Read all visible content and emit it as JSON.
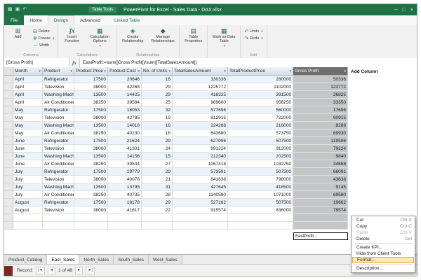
{
  "window": {
    "title": "PowerPivot for Excel - Sales Data - DAX.xlsx",
    "contextual_group": "Table Tools"
  },
  "icons": {
    "app": "▦",
    "save": "▣",
    "undo_small": "↶",
    "minimize": "─",
    "maximize": "□",
    "close": "×",
    "filter": "▾",
    "dropdown": "▾",
    "add": "⊞",
    "delete": "⊟",
    "freeze": "❄",
    "width": "↔",
    "insert_function": "fx",
    "calculation_options": "▦",
    "create_relationship": "◈",
    "manage_relationships": "◆",
    "table_properties": "▤",
    "mark_as_date_table": "▦",
    "undo": "↶",
    "redo": "↷",
    "nav_first": "|◄",
    "nav_prev": "◄",
    "nav_next": "►",
    "nav_last": "►|"
  },
  "ribbon_tabs": [
    {
      "label": "File",
      "file": true
    },
    {
      "label": "Home"
    },
    {
      "label": "Design",
      "active": true
    },
    {
      "label": "Advanced"
    },
    {
      "label": "Linked Table",
      "contextual": true
    }
  ],
  "ribbon": {
    "add": "Add",
    "delete": "Delete",
    "freeze": "Freeze",
    "width": "Width",
    "insert_function": "Insert Function",
    "calculation_options": "Calculation Options",
    "create_relationship": "Create Relationship",
    "manage_relationships": "Manage Relationships",
    "table_properties": "Table Properties",
    "mark_as_date_table": "Mark as Date Table",
    "undo": "Undo",
    "redo": "Redo",
    "groups": {
      "columns": "Columns",
      "calculations": "Calculations",
      "relationships": "Relationships",
      "edit": "Edit"
    }
  },
  "formula_bar": {
    "name_box": "[Gross Profit]",
    "formula": "EastProfit:=sum([Gross Profit])/sum([TotalSalesAmount])"
  },
  "table": {
    "headers": [
      "Month",
      "Product",
      "Product Price",
      "Product Cost",
      "No. of Units",
      "TotalSalesAmount",
      "TotalProductPrice",
      "Gross Profit"
    ],
    "add_column_label": "Add Column",
    "selected_column": "Gross Profit",
    "rows": [
      [
        "April",
        "Refrigerator",
        "17500",
        "20646",
        "16",
        "330336",
        "280000",
        "50336"
      ],
      [
        "April",
        "Television",
        "38000",
        "42268",
        "29",
        "1225772",
        "1102000",
        "123772"
      ],
      [
        "April",
        "Washing Machine",
        "13500",
        "14425",
        "29",
        "418325",
        "391500",
        "26825"
      ],
      [
        "April",
        "Air Conditioner",
        "38250",
        "39584",
        "25",
        "989600",
        "956250",
        "33350"
      ],
      [
        "May",
        "Refrigerator",
        "17500",
        "18053",
        "32",
        "577696",
        "560000",
        "17696"
      ],
      [
        "May",
        "Television",
        "38000",
        "42785",
        "19",
        "812915",
        "722000",
        "90915"
      ],
      [
        "May",
        "Washing Machine",
        "13500",
        "14018",
        "16",
        "224288",
        "216000",
        "8288"
      ],
      [
        "May",
        "Air Conditioner",
        "38250",
        "40230",
        "16",
        "643680",
        "573750",
        "69930"
      ],
      [
        "June",
        "Refrigerator",
        "17500",
        "21624",
        "29",
        "627096",
        "507500",
        "119596"
      ],
      [
        "June",
        "Television",
        "38000",
        "41301",
        "24",
        "991224",
        "912000",
        "79224"
      ],
      [
        "June",
        "Washing Machine",
        "13500",
        "14156",
        "15",
        "212340",
        "202500",
        "9840"
      ],
      [
        "June",
        "Air Conditioner",
        "38250",
        "39534",
        "27",
        "1067418",
        "1032750",
        "34668"
      ],
      [
        "July",
        "Refrigerator",
        "17500",
        "19779",
        "29",
        "573591",
        "507500",
        "66091"
      ],
      [
        "July",
        "Television",
        "38000",
        "40078",
        "21",
        "841638",
        "798000",
        "43638"
      ],
      [
        "July",
        "Washing Machine",
        "13500",
        "13795",
        "31",
        "427645",
        "418500",
        "9145"
      ],
      [
        "July",
        "Air Conditioner",
        "38250",
        "40735",
        "28",
        "1140580",
        "1071000",
        "69580"
      ],
      [
        "August",
        "Refrigerator",
        "17500",
        "18178",
        "29",
        "527162",
        "507500",
        "19662"
      ],
      [
        "August",
        "Television",
        "38000",
        "41617",
        "22",
        "915574",
        "836000",
        "79574"
      ]
    ],
    "measure_cell": "EastProfit..."
  },
  "context_menu": {
    "items": [
      {
        "label": "Cut",
        "shortcut": "Ctrl-X"
      },
      {
        "label": "Copy",
        "shortcut": "Ctrl-C"
      },
      {
        "label": "Paste",
        "shortcut": "Ctrl-V",
        "disabled": true
      },
      {
        "label": "Delete",
        "shortcut": "Del"
      },
      {
        "separator": true
      },
      {
        "label": "Create KPI..."
      },
      {
        "label": "Hide from Client Tools"
      },
      {
        "label": "Format...",
        "highlighted": true
      },
      {
        "separator": true
      },
      {
        "label": "Description..."
      }
    ]
  },
  "sheet_tabs": [
    {
      "label": "Product_Catalog"
    },
    {
      "label": "East_Sales",
      "active": true
    },
    {
      "label": "North_Sales"
    },
    {
      "label": "South_Sales"
    },
    {
      "label": "West_Sales"
    }
  ],
  "status": {
    "record_label": "Record:",
    "record_position": "1 of 48"
  }
}
